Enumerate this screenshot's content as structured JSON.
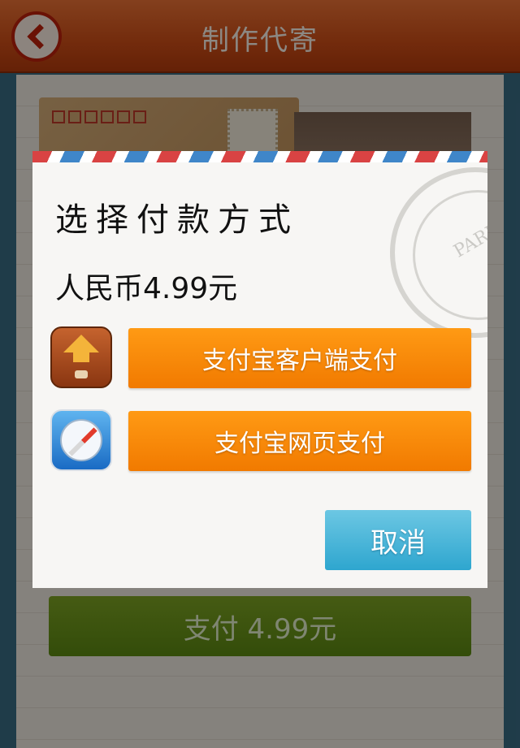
{
  "header": {
    "title": "制作代寄",
    "back_icon": "back-arrow-icon"
  },
  "background": {
    "pay_button_label": "支付  4.99元"
  },
  "dialog": {
    "title": "选择付款方式",
    "price": "人民币4.99元",
    "postmark_text": "PARIS",
    "options": [
      {
        "label": "支付宝客户端支付",
        "icon": "wallet-icon"
      },
      {
        "label": "支付宝网页支付",
        "icon": "compass-icon"
      }
    ],
    "cancel_label": "取消"
  },
  "colors": {
    "header": "#d9541c",
    "option_button": "#f88a08",
    "cancel_button": "#45b3d8",
    "pay_button": "#6f9a1c"
  }
}
